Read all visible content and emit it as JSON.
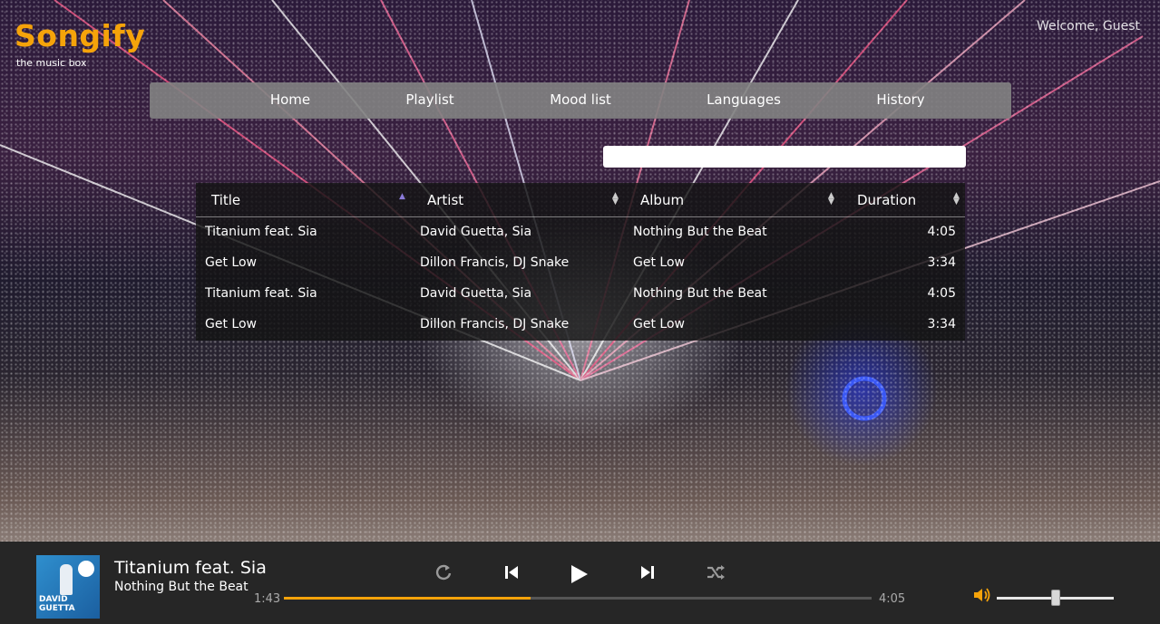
{
  "app": {
    "logo": "Songify",
    "tagline": "the music box",
    "welcome": "Welcome, Guest"
  },
  "nav": {
    "items": [
      "Home",
      "Playlist",
      "Mood list",
      "Languages",
      "History"
    ]
  },
  "search": {
    "value": "",
    "placeholder": ""
  },
  "table": {
    "headers": [
      "Title",
      "Artist",
      "Album",
      "Duration"
    ],
    "rows": [
      [
        "Titanium feat. Sia",
        "David Guetta, Sia",
        "Nothing But the Beat",
        "4:05"
      ],
      [
        "Get Low",
        "Dillon Francis, DJ Snake",
        "Get Low",
        "3:34"
      ],
      [
        "Titanium feat. Sia",
        "David Guetta, Sia",
        "Nothing But the Beat",
        "4:05"
      ],
      [
        "Get Low",
        "Dillon Francis, DJ Snake",
        "Get Low",
        "3:34"
      ]
    ]
  },
  "player": {
    "title": "Titanium feat. Sia",
    "album": "Nothing But the Beat",
    "cover_text": "DAVID GUETTA",
    "elapsed": "1:43",
    "total": "4:05",
    "progress_fraction": 0.42,
    "volume_fraction": 0.5,
    "icons": [
      "repeat-icon",
      "previous-icon",
      "play-icon",
      "next-icon",
      "shuffle-icon",
      "volume-icon"
    ]
  },
  "colors": {
    "accent": "#f5a30a",
    "player_bg": "#262626",
    "navbar_bg": "#828282"
  }
}
